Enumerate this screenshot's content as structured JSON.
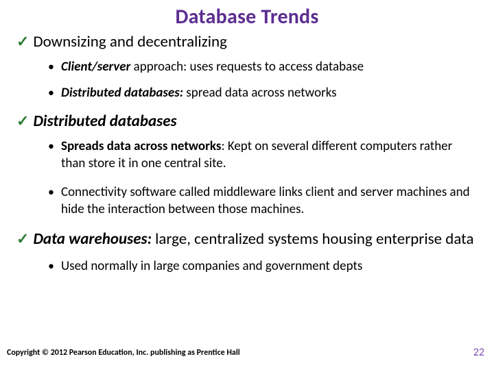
{
  "title": "Database Trends",
  "items": [
    {
      "text_html": "Downsizing and decentralizing",
      "subs": [
        {
          "text_html": "<b><i>Client/server</i></b> approach: uses requests to access database"
        },
        {
          "text_html": "<b><i>Distributed databases:</i></b> spread data across networks"
        }
      ]
    },
    {
      "text_html": "<b><i>Distributed databases</i></b>",
      "subs": [
        {
          "text_html": "<b>Spreads data across networks</b>: Kept on several different computers rather than store it in one central site."
        },
        {
          "text_html": "Connectivity software called middleware links client and server machines  and hide the interaction between those machines."
        }
      ]
    },
    {
      "text_html": "<b><i>Data warehouses:</i></b> large, centralized systems housing enterprise data",
      "subs": [
        {
          "text_html": "Used normally in large companies and  government depts"
        }
      ]
    }
  ],
  "footer": "Copyright © 2012 Pearson Education, Inc. publishing as Prentice Hall",
  "page": "22"
}
